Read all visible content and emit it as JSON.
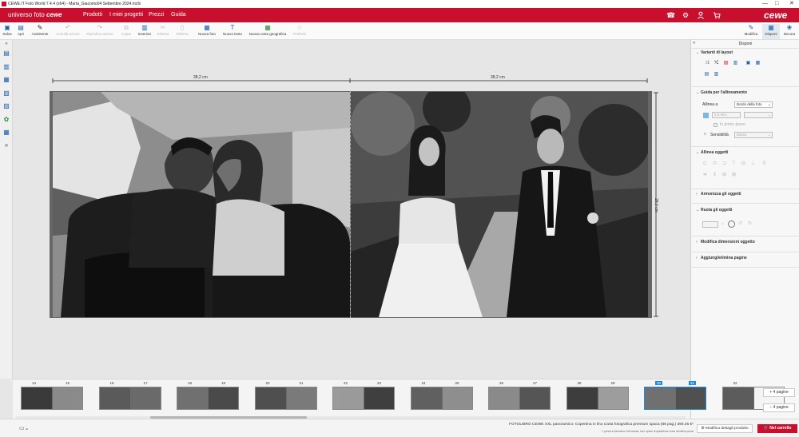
{
  "window": {
    "title": "CEWE.IT Foto World 7.4.4 (x64) - Marta_Giacomo04 Settembre 2024.mcfx",
    "controls": {
      "minimize": "—",
      "maximize": "□",
      "close": "✕"
    }
  },
  "nav": {
    "brand_prefix": "universo foto",
    "brand_suffix": "cewe",
    "items": [
      "Prodotti",
      "I miei progetti",
      "Prezzi",
      "Guida"
    ],
    "logo": "cewe",
    "icons": {
      "phone": "phone-icon",
      "settings": "gear-icon",
      "user": "user-icon",
      "cart": "cart-icon"
    }
  },
  "toolbar": {
    "items": [
      {
        "label": "Salva",
        "icon": "💾",
        "disabled": false
      },
      {
        "label": "Apri",
        "icon": "📂",
        "disabled": false
      },
      {
        "label": "Assistente",
        "icon": "✎",
        "disabled": false
      },
      {
        "label": "Annulla azione",
        "icon": "↶",
        "disabled": true
      },
      {
        "label": "Ripristina azione",
        "icon": "↷",
        "disabled": true
      },
      {
        "label": "Copia",
        "icon": "⧉",
        "disabled": true
      },
      {
        "label": "Inserisci",
        "icon": "📋",
        "disabled": false
      },
      {
        "label": "Elimina",
        "icon": "✂",
        "disabled": true
      },
      {
        "label": "Elimina",
        "icon": "🗑",
        "disabled": true
      },
      {
        "label": "Nuova foto",
        "icon": "🖼",
        "disabled": false
      },
      {
        "label": "Nuovo testo",
        "icon": "T",
        "disabled": false
      },
      {
        "label": "Nuova carta geografica",
        "icon": "🗺",
        "disabled": false
      },
      {
        "label": "Preferiti",
        "icon": "☆",
        "disabled": true
      }
    ],
    "right": [
      {
        "label": "Modifica",
        "icon": "✎",
        "active": false
      },
      {
        "label": "Disponi",
        "icon": "▦",
        "active": true
      },
      {
        "label": "Decora",
        "icon": "❀",
        "active": false
      }
    ]
  },
  "canvas": {
    "width_left": "38,2 cm",
    "width_right": "38,2 cm",
    "height": "28,0 cm"
  },
  "zoom": {
    "level_fraction": 0.15
  },
  "right_panel": {
    "title": "Disponi",
    "layout_variants": "Varianti di layout",
    "alignment_guide": "Guida per l'allineamento",
    "align_to_label": "Allinea a",
    "align_to_value": "Bordo della foto",
    "margin_value": "5,0 mm",
    "foreground_label": "In primo piano",
    "sensitivity_label": "Sensibilità",
    "sensitivity_value": "bassa",
    "align_objects": "Allinea oggetti",
    "harmonize_objects": "Armonizza gli oggetti",
    "rotate_objects": "Ruota gli oggetti",
    "resize_objects": "Modifica dimensioni oggetto",
    "add_remove_pages": "Aggiungi/elimina pagine"
  },
  "filmstrip": {
    "spreads": [
      {
        "left": "14",
        "right": "15",
        "selected": false
      },
      {
        "left": "16",
        "right": "17",
        "selected": false
      },
      {
        "left": "18",
        "right": "19",
        "selected": false
      },
      {
        "left": "20",
        "right": "21",
        "selected": false
      },
      {
        "left": "22",
        "right": "23",
        "selected": false
      },
      {
        "left": "24",
        "right": "25",
        "selected": false
      },
      {
        "left": "26",
        "right": "27",
        "selected": false
      },
      {
        "left": "28",
        "right": "29",
        "selected": false
      },
      {
        "left": "30",
        "right": "31",
        "selected": true
      },
      {
        "left": "32",
        "right": "",
        "selected": false
      }
    ],
    "add_pages": "+ 4 pagine",
    "remove_pages": "− 4 pagine"
  },
  "status": {
    "product": "FOTOLIBRO CEWE XXL panoramico: Copertina in lino Carta fotografica premium opaca (86 pag.) 390,45 €*",
    "note": "* i prezzi si intendono IVA inclusa, escl. spese di spedizione come da listino prezzi",
    "modify_details": "Modifica dettagli prodotto",
    "cart": "Nel carrello"
  }
}
